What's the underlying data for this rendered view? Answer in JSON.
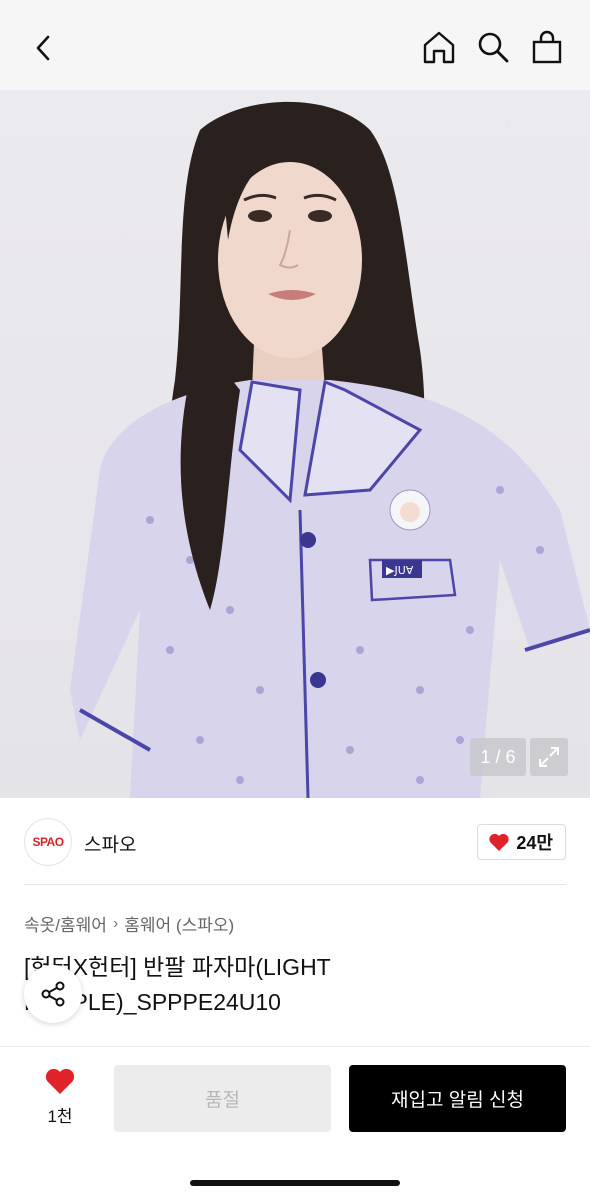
{
  "header": {
    "back_icon": "chevron-left-icon",
    "home_icon": "home-icon",
    "search_icon": "search-icon",
    "bag_icon": "shopping-bag-icon"
  },
  "gallery": {
    "counter": "1 / 6",
    "expand_icon": "expand-icon",
    "pocket_tag": "▶JU∀"
  },
  "brand": {
    "logo_text": "SPAO",
    "name": "스파오",
    "like_count": "24만",
    "like_icon": "heart-icon",
    "accent": "#e0232b"
  },
  "breadcrumb": {
    "items": [
      "속옷/홈웨어",
      "홈웨어 (스파오)"
    ],
    "separator": "›"
  },
  "product": {
    "title": "[헌터X헌터] 반팔 파자마(LIGHT PURPLE)_SPPPE24U10"
  },
  "share": {
    "icon": "share-icon"
  },
  "bottom": {
    "wish_count": "1천",
    "soldout_label": "품절",
    "restock_label": "재입고 알림 신청"
  }
}
